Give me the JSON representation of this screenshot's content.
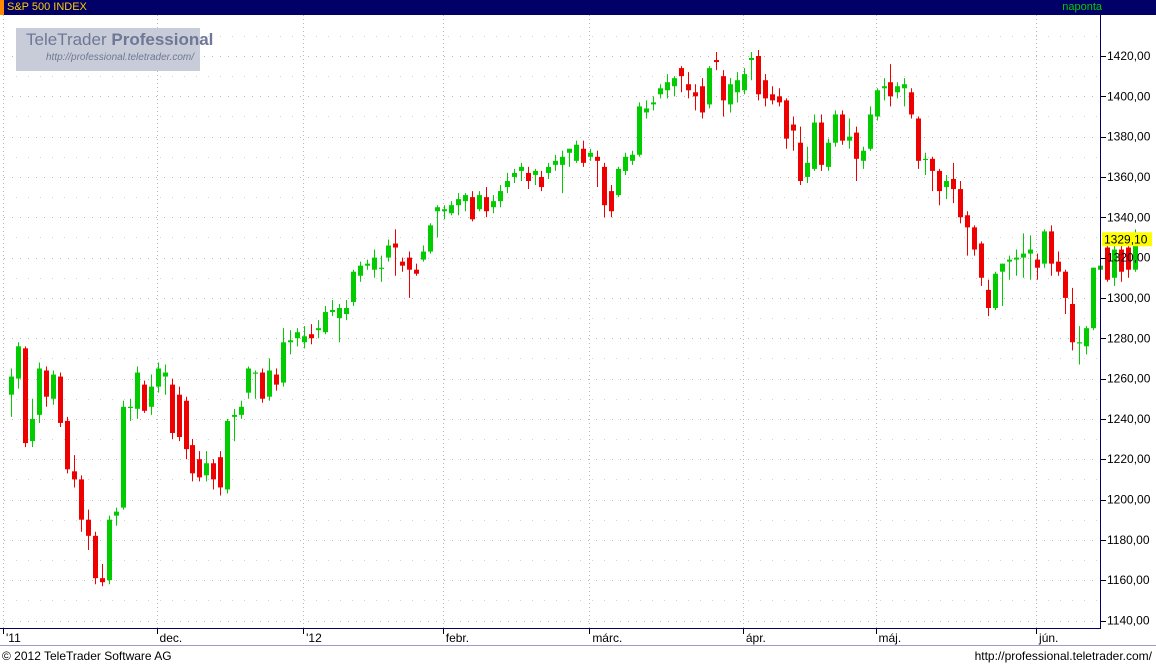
{
  "header": {
    "title": "S&P 500 INDEX",
    "period": "naponta"
  },
  "logo": {
    "name_regular": "TeleTrader ",
    "name_bold": "Professional",
    "site": "http://professional.teletrader.com/"
  },
  "footer": {
    "copyright": "© 2012 TeleTrader Software AG",
    "url": "http://professional.teletrader.com/"
  },
  "colors": {
    "up": "#00cc00",
    "down": "#ee0000",
    "last_price_label": "#ffff00",
    "frame": "#000066"
  },
  "chart_data": {
    "type": "candlestick",
    "title": "S&P 500 INDEX",
    "ylim": [
      1132,
      1440
    ],
    "yticks": [
      1140,
      1160,
      1180,
      1200,
      1220,
      1240,
      1260,
      1280,
      1300,
      1320,
      1340,
      1360,
      1380,
      1400,
      1420
    ],
    "ytick_labels": [
      "1140,00",
      "1160,00",
      "1180,00",
      "1200,00",
      "1220,00",
      "1240,00",
      "1260,00",
      "1280,00",
      "1300,00",
      "1320,00",
      "1340,00",
      "1360,00",
      "1380,00",
      "1400,00",
      "1420,00"
    ],
    "x_labels": [
      {
        "label": "'11",
        "index": 0
      },
      {
        "label": "dec.",
        "index": 22
      },
      {
        "label": "'12",
        "index": 43
      },
      {
        "label": "febr.",
        "index": 63
      },
      {
        "label": "márc.",
        "index": 84
      },
      {
        "label": "ápr.",
        "index": 106
      },
      {
        "label": "máj.",
        "index": 125
      },
      {
        "label": "jún.",
        "index": 148
      }
    ],
    "last_price": 1329.1,
    "last_price_label": "1329,10",
    "grid": true,
    "candles": [
      {
        "o": 1252,
        "h": 1265,
        "l": 1241,
        "c": 1261
      },
      {
        "o": 1260,
        "h": 1278,
        "l": 1255,
        "c": 1276
      },
      {
        "o": 1275,
        "h": 1276,
        "l": 1226,
        "c": 1228
      },
      {
        "o": 1229,
        "h": 1250,
        "l": 1226,
        "c": 1240
      },
      {
        "o": 1242,
        "h": 1268,
        "l": 1238,
        "c": 1265
      },
      {
        "o": 1264,
        "h": 1266,
        "l": 1246,
        "c": 1251
      },
      {
        "o": 1250,
        "h": 1264,
        "l": 1247,
        "c": 1262
      },
      {
        "o": 1261,
        "h": 1263,
        "l": 1236,
        "c": 1238
      },
      {
        "o": 1239,
        "h": 1241,
        "l": 1213,
        "c": 1215
      },
      {
        "o": 1214,
        "h": 1222,
        "l": 1206,
        "c": 1210
      },
      {
        "o": 1210,
        "h": 1212,
        "l": 1184,
        "c": 1190
      },
      {
        "o": 1190,
        "h": 1195,
        "l": 1175,
        "c": 1182
      },
      {
        "o": 1182,
        "h": 1184,
        "l": 1158,
        "c": 1161
      },
      {
        "o": 1161,
        "h": 1168,
        "l": 1157,
        "c": 1159
      },
      {
        "o": 1160,
        "h": 1192,
        "l": 1158,
        "c": 1190
      },
      {
        "o": 1192,
        "h": 1196,
        "l": 1187,
        "c": 1194
      },
      {
        "o": 1196,
        "h": 1249,
        "l": 1195,
        "c": 1246
      },
      {
        "o": 1246,
        "h": 1250,
        "l": 1239,
        "c": 1246
      },
      {
        "o": 1245,
        "h": 1266,
        "l": 1240,
        "c": 1263
      },
      {
        "o": 1257,
        "h": 1259,
        "l": 1243,
        "c": 1244
      },
      {
        "o": 1246,
        "h": 1262,
        "l": 1242,
        "c": 1256
      },
      {
        "o": 1256,
        "h": 1268,
        "l": 1253,
        "c": 1265
      },
      {
        "o": 1261,
        "h": 1267,
        "l": 1252,
        "c": 1263
      },
      {
        "o": 1257,
        "h": 1260,
        "l": 1230,
        "c": 1233
      },
      {
        "o": 1252,
        "h": 1256,
        "l": 1229,
        "c": 1231
      },
      {
        "o": 1249,
        "h": 1251,
        "l": 1220,
        "c": 1225
      },
      {
        "o": 1227,
        "h": 1230,
        "l": 1209,
        "c": 1213
      },
      {
        "o": 1220,
        "h": 1224,
        "l": 1209,
        "c": 1211
      },
      {
        "o": 1212,
        "h": 1224,
        "l": 1209,
        "c": 1218
      },
      {
        "o": 1218,
        "h": 1220,
        "l": 1205,
        "c": 1210
      },
      {
        "o": 1221,
        "h": 1224,
        "l": 1202,
        "c": 1206
      },
      {
        "o": 1205,
        "h": 1240,
        "l": 1203,
        "c": 1239
      },
      {
        "o": 1241,
        "h": 1245,
        "l": 1229,
        "c": 1242
      },
      {
        "o": 1242,
        "h": 1249,
        "l": 1240,
        "c": 1246
      },
      {
        "o": 1253,
        "h": 1266,
        "l": 1250,
        "c": 1265
      },
      {
        "o": 1263,
        "h": 1264,
        "l": 1250,
        "c": 1263
      },
      {
        "o": 1263,
        "h": 1265,
        "l": 1248,
        "c": 1250
      },
      {
        "o": 1251,
        "h": 1270,
        "l": 1249,
        "c": 1264
      },
      {
        "o": 1262,
        "h": 1265,
        "l": 1254,
        "c": 1257
      },
      {
        "o": 1258,
        "h": 1285,
        "l": 1256,
        "c": 1278
      },
      {
        "o": 1278,
        "h": 1284,
        "l": 1272,
        "c": 1279
      },
      {
        "o": 1280,
        "h": 1285,
        "l": 1276,
        "c": 1283
      },
      {
        "o": 1278,
        "h": 1286,
        "l": 1275,
        "c": 1281
      },
      {
        "o": 1282,
        "h": 1287,
        "l": 1277,
        "c": 1280
      },
      {
        "o": 1284,
        "h": 1289,
        "l": 1280,
        "c": 1285
      },
      {
        "o": 1283,
        "h": 1296,
        "l": 1282,
        "c": 1293
      },
      {
        "o": 1293,
        "h": 1299,
        "l": 1291,
        "c": 1294
      },
      {
        "o": 1290,
        "h": 1297,
        "l": 1278,
        "c": 1295
      },
      {
        "o": 1292,
        "h": 1299,
        "l": 1289,
        "c": 1295
      },
      {
        "o": 1298,
        "h": 1314,
        "l": 1296,
        "c": 1313
      },
      {
        "o": 1311,
        "h": 1318,
        "l": 1308,
        "c": 1316
      },
      {
        "o": 1316,
        "h": 1319,
        "l": 1314,
        "c": 1317
      },
      {
        "o": 1314,
        "h": 1324,
        "l": 1310,
        "c": 1320
      },
      {
        "o": 1315,
        "h": 1321,
        "l": 1308,
        "c": 1315
      },
      {
        "o": 1320,
        "h": 1329,
        "l": 1318,
        "c": 1326
      },
      {
        "o": 1327,
        "h": 1334,
        "l": 1311,
        "c": 1325
      },
      {
        "o": 1318,
        "h": 1320,
        "l": 1313,
        "c": 1316
      },
      {
        "o": 1320,
        "h": 1323,
        "l": 1300,
        "c": 1314
      },
      {
        "o": 1314,
        "h": 1317,
        "l": 1311,
        "c": 1312
      },
      {
        "o": 1319,
        "h": 1326,
        "l": 1318,
        "c": 1323
      },
      {
        "o": 1323,
        "h": 1337,
        "l": 1322,
        "c": 1336
      },
      {
        "o": 1343,
        "h": 1346,
        "l": 1330,
        "c": 1345
      },
      {
        "o": 1343,
        "h": 1346,
        "l": 1339,
        "c": 1344
      },
      {
        "o": 1342,
        "h": 1348,
        "l": 1341,
        "c": 1346
      },
      {
        "o": 1346,
        "h": 1352,
        "l": 1341,
        "c": 1349
      },
      {
        "o": 1348,
        "h": 1352,
        "l": 1343,
        "c": 1351
      },
      {
        "o": 1350,
        "h": 1353,
        "l": 1338,
        "c": 1339
      },
      {
        "o": 1344,
        "h": 1353,
        "l": 1343,
        "c": 1351
      },
      {
        "o": 1350,
        "h": 1355,
        "l": 1340,
        "c": 1343
      },
      {
        "o": 1345,
        "h": 1351,
        "l": 1342,
        "c": 1348
      },
      {
        "o": 1348,
        "h": 1356,
        "l": 1345,
        "c": 1353
      },
      {
        "o": 1355,
        "h": 1362,
        "l": 1352,
        "c": 1358
      },
      {
        "o": 1360,
        "h": 1364,
        "l": 1357,
        "c": 1362
      },
      {
        "o": 1363,
        "h": 1367,
        "l": 1358,
        "c": 1365
      },
      {
        "o": 1362,
        "h": 1365,
        "l": 1354,
        "c": 1358
      },
      {
        "o": 1361,
        "h": 1364,
        "l": 1356,
        "c": 1363
      },
      {
        "o": 1360,
        "h": 1363,
        "l": 1353,
        "c": 1355
      },
      {
        "o": 1362,
        "h": 1367,
        "l": 1359,
        "c": 1365
      },
      {
        "o": 1366,
        "h": 1371,
        "l": 1363,
        "c": 1368
      },
      {
        "o": 1366,
        "h": 1373,
        "l": 1352,
        "c": 1370
      },
      {
        "o": 1372,
        "h": 1374,
        "l": 1365,
        "c": 1374
      },
      {
        "o": 1368,
        "h": 1378,
        "l": 1367,
        "c": 1376
      },
      {
        "o": 1374,
        "h": 1378,
        "l": 1365,
        "c": 1367
      },
      {
        "o": 1370,
        "h": 1374,
        "l": 1368,
        "c": 1372
      },
      {
        "o": 1370,
        "h": 1373,
        "l": 1355,
        "c": 1368
      },
      {
        "o": 1365,
        "h": 1367,
        "l": 1340,
        "c": 1346
      },
      {
        "o": 1353,
        "h": 1356,
        "l": 1340,
        "c": 1343
      },
      {
        "o": 1351,
        "h": 1365,
        "l": 1350,
        "c": 1364
      },
      {
        "o": 1363,
        "h": 1372,
        "l": 1361,
        "c": 1370
      },
      {
        "o": 1368,
        "h": 1373,
        "l": 1366,
        "c": 1371
      },
      {
        "o": 1371,
        "h": 1397,
        "l": 1370,
        "c": 1395
      },
      {
        "o": 1392,
        "h": 1398,
        "l": 1389,
        "c": 1394
      },
      {
        "o": 1396,
        "h": 1400,
        "l": 1393,
        "c": 1397
      },
      {
        "o": 1401,
        "h": 1406,
        "l": 1399,
        "c": 1404
      },
      {
        "o": 1403,
        "h": 1411,
        "l": 1399,
        "c": 1407
      },
      {
        "o": 1405,
        "h": 1410,
        "l": 1400,
        "c": 1409
      },
      {
        "o": 1414,
        "h": 1415,
        "l": 1402,
        "c": 1410
      },
      {
        "o": 1406,
        "h": 1412,
        "l": 1399,
        "c": 1403
      },
      {
        "o": 1402,
        "h": 1406,
        "l": 1393,
        "c": 1400
      },
      {
        "o": 1405,
        "h": 1409,
        "l": 1389,
        "c": 1392
      },
      {
        "o": 1396,
        "h": 1415,
        "l": 1394,
        "c": 1414
      },
      {
        "o": 1418,
        "h": 1422,
        "l": 1413,
        "c": 1417
      },
      {
        "o": 1410,
        "h": 1413,
        "l": 1390,
        "c": 1398
      },
      {
        "o": 1396,
        "h": 1409,
        "l": 1392,
        "c": 1406
      },
      {
        "o": 1402,
        "h": 1412,
        "l": 1397,
        "c": 1408
      },
      {
        "o": 1403,
        "h": 1414,
        "l": 1401,
        "c": 1411
      },
      {
        "o": 1418,
        "h": 1422,
        "l": 1408,
        "c": 1419
      },
      {
        "o": 1420,
        "h": 1423,
        "l": 1398,
        "c": 1401
      },
      {
        "o": 1408,
        "h": 1411,
        "l": 1395,
        "c": 1399
      },
      {
        "o": 1401,
        "h": 1405,
        "l": 1396,
        "c": 1398
      },
      {
        "o": 1400,
        "h": 1404,
        "l": 1395,
        "c": 1397
      },
      {
        "o": 1398,
        "h": 1399,
        "l": 1374,
        "c": 1379
      },
      {
        "o": 1386,
        "h": 1390,
        "l": 1373,
        "c": 1383
      },
      {
        "o": 1377,
        "h": 1385,
        "l": 1356,
        "c": 1358
      },
      {
        "o": 1360,
        "h": 1375,
        "l": 1357,
        "c": 1367
      },
      {
        "o": 1364,
        "h": 1391,
        "l": 1363,
        "c": 1387
      },
      {
        "o": 1387,
        "h": 1391,
        "l": 1363,
        "c": 1366
      },
      {
        "o": 1365,
        "h": 1379,
        "l": 1363,
        "c": 1377
      },
      {
        "o": 1377,
        "h": 1393,
        "l": 1375,
        "c": 1391
      },
      {
        "o": 1391,
        "h": 1393,
        "l": 1376,
        "c": 1378
      },
      {
        "o": 1378,
        "h": 1389,
        "l": 1374,
        "c": 1380
      },
      {
        "o": 1382,
        "h": 1385,
        "l": 1358,
        "c": 1369
      },
      {
        "o": 1368,
        "h": 1375,
        "l": 1364,
        "c": 1373
      },
      {
        "o": 1374,
        "h": 1395,
        "l": 1373,
        "c": 1391
      },
      {
        "o": 1390,
        "h": 1404,
        "l": 1388,
        "c": 1403
      },
      {
        "o": 1404,
        "h": 1409,
        "l": 1398,
        "c": 1405
      },
      {
        "o": 1407,
        "h": 1416,
        "l": 1395,
        "c": 1400
      },
      {
        "o": 1402,
        "h": 1407,
        "l": 1399,
        "c": 1405
      },
      {
        "o": 1404,
        "h": 1409,
        "l": 1395,
        "c": 1406
      },
      {
        "o": 1402,
        "h": 1404,
        "l": 1389,
        "c": 1391
      },
      {
        "o": 1389,
        "h": 1390,
        "l": 1364,
        "c": 1368
      },
      {
        "o": 1369,
        "h": 1372,
        "l": 1361,
        "c": 1369
      },
      {
        "o": 1369,
        "h": 1370,
        "l": 1353,
        "c": 1363
      },
      {
        "o": 1363,
        "h": 1364,
        "l": 1346,
        "c": 1353
      },
      {
        "o": 1355,
        "h": 1361,
        "l": 1349,
        "c": 1358
      },
      {
        "o": 1359,
        "h": 1367,
        "l": 1347,
        "c": 1354
      },
      {
        "o": 1354,
        "h": 1358,
        "l": 1337,
        "c": 1340
      },
      {
        "o": 1341,
        "h": 1343,
        "l": 1321,
        "c": 1335
      },
      {
        "o": 1335,
        "h": 1336,
        "l": 1321,
        "c": 1324
      },
      {
        "o": 1327,
        "h": 1328,
        "l": 1306,
        "c": 1310
      },
      {
        "o": 1304,
        "h": 1309,
        "l": 1291,
        "c": 1295
      },
      {
        "o": 1295,
        "h": 1313,
        "l": 1294,
        "c": 1312
      },
      {
        "o": 1313,
        "h": 1317,
        "l": 1296,
        "c": 1317
      },
      {
        "o": 1318,
        "h": 1321,
        "l": 1309,
        "c": 1319
      },
      {
        "o": 1319,
        "h": 1324,
        "l": 1311,
        "c": 1320
      },
      {
        "o": 1320,
        "h": 1332,
        "l": 1310,
        "c": 1322
      },
      {
        "o": 1322,
        "h": 1331,
        "l": 1309,
        "c": 1324
      },
      {
        "o": 1319,
        "h": 1322,
        "l": 1309,
        "c": 1315
      },
      {
        "o": 1317,
        "h": 1334,
        "l": 1315,
        "c": 1333
      },
      {
        "o": 1333,
        "h": 1336,
        "l": 1311,
        "c": 1317
      },
      {
        "o": 1318,
        "h": 1323,
        "l": 1311,
        "c": 1313
      },
      {
        "o": 1313,
        "h": 1314,
        "l": 1292,
        "c": 1300
      },
      {
        "o": 1297,
        "h": 1305,
        "l": 1274,
        "c": 1278
      },
      {
        "o": 1278,
        "h": 1286,
        "l": 1267,
        "c": 1278
      },
      {
        "o": 1276,
        "h": 1286,
        "l": 1272,
        "c": 1285
      },
      {
        "o": 1285,
        "h": 1315,
        "l": 1284,
        "c": 1315
      },
      {
        "o": 1314,
        "h": 1325,
        "l": 1310,
        "c": 1316
      },
      {
        "o": 1325,
        "h": 1327,
        "l": 1308,
        "c": 1309
      },
      {
        "o": 1310,
        "h": 1331,
        "l": 1306,
        "c": 1324
      },
      {
        "o": 1324,
        "h": 1327,
        "l": 1308,
        "c": 1313
      },
      {
        "o": 1325,
        "h": 1326,
        "l": 1310,
        "c": 1314
      },
      {
        "o": 1314,
        "h": 1334,
        "l": 1313,
        "c": 1329
      }
    ]
  }
}
